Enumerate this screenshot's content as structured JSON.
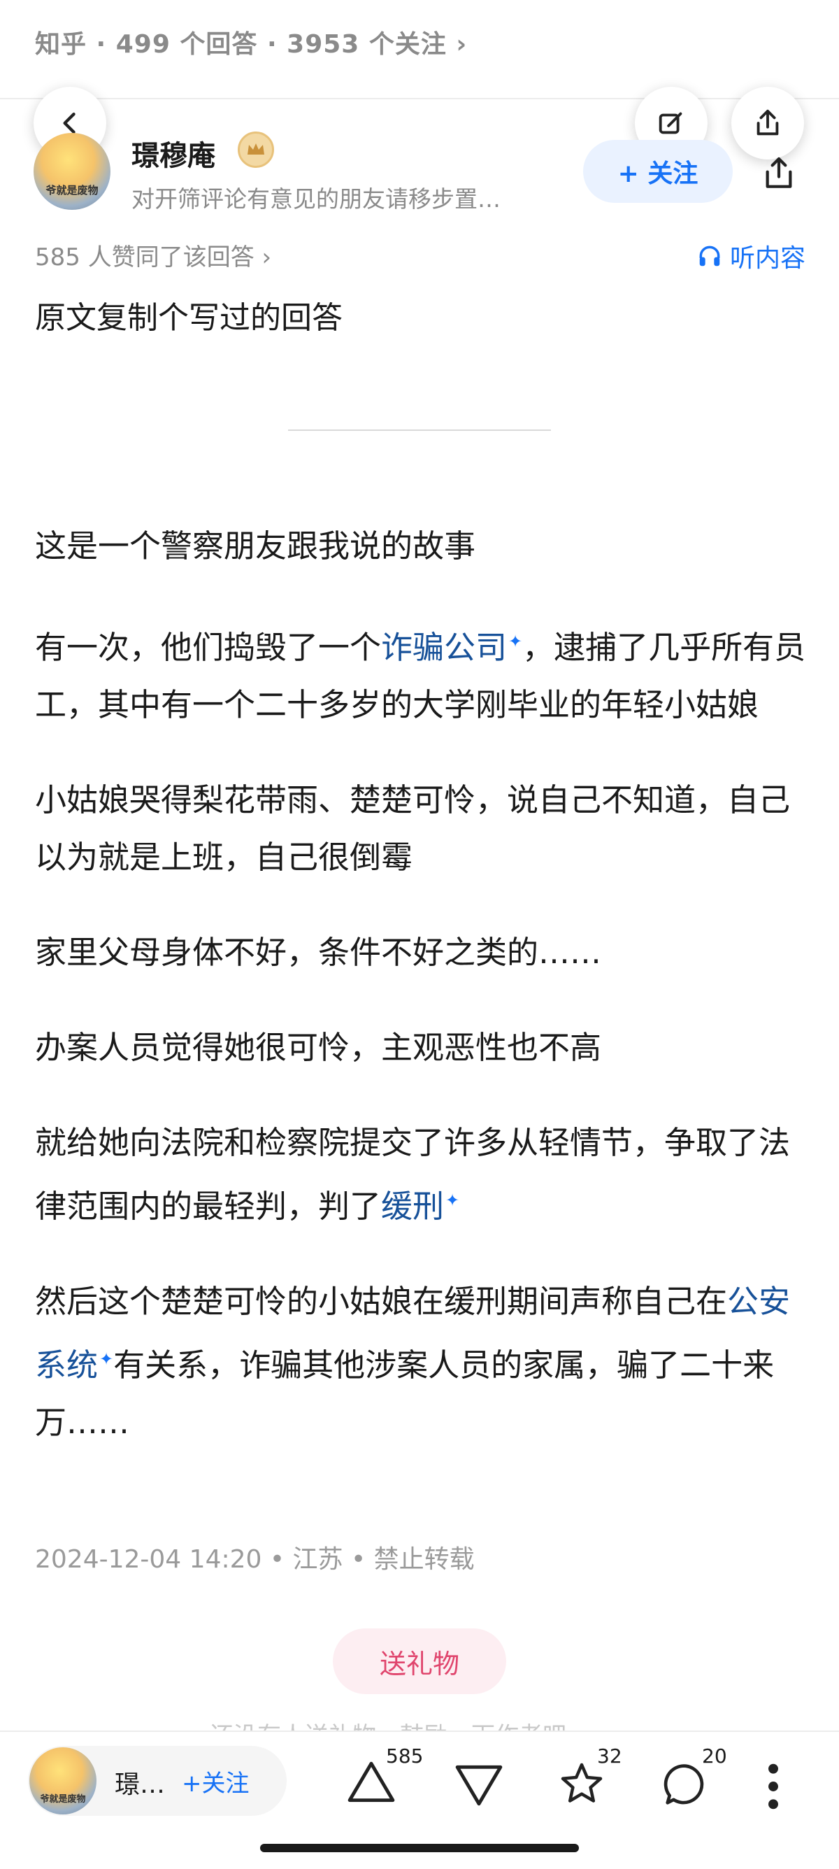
{
  "topbar": {
    "meta": "知乎 · 499 个回答 · 3953 个关注 ›"
  },
  "author": {
    "name": "璟穆庵",
    "avatar_caption": "爷就是废物",
    "bio": "对开筛评论有意见的朋友请移步置…",
    "follow_label": "+ 关注"
  },
  "answer": {
    "upvoted": "585 人赞同了该回答 ›",
    "listen_label": "听内容",
    "intro": "原文复制个写过的回答",
    "p1": "这是一个警察朋友跟我说的故事",
    "p2_a": "有一次，他们捣毁了一个",
    "p2_kw": "诈骗公司",
    "p2_b": "，逮捕了几乎所有员工，其中有一个二十多岁的大学刚毕业的年轻小姑娘",
    "p3": "小姑娘哭得梨花带雨、楚楚可怜，说自己不知道，自己以为就是上班，自己很倒霉",
    "p4": "家里父母身体不好，条件不好之类的……",
    "p5": "办案人员觉得她很可怜，主观恶性也不高",
    "p6_a": "就给她向法院和检察院提交了许多从轻情节，争取了法律范围内的最轻判，判了",
    "p6_kw": "缓刑",
    "p7_a": "然后这个楚楚可怜的小姑娘在缓刑期间声称自己在",
    "p7_kw": "公安系统",
    "p7_b": "有关系，诈骗其他涉案人员的家属，骗了二十来万……",
    "footer_meta": "2024-12-04 14:20 • 江苏 • 禁止转载",
    "gift_label": "送礼物",
    "faded_text": "还没有人送礼物，鼓励一下作者吧"
  },
  "bottombar": {
    "mini_name": "璟…",
    "mini_follow": "+关注",
    "mini_avatar_caption": "爷就是废物",
    "upvote_count": "585",
    "favorite_count": "32",
    "comment_count": "20"
  },
  "icons": {
    "back": "chevron-left-icon",
    "edit": "edit-icon",
    "share": "share-icon",
    "headphones": "headphones-icon",
    "upvote": "triangle-up-icon",
    "downvote": "triangle-down-icon",
    "favorite": "star-icon",
    "comment": "comment-icon",
    "more": "more-vertical-icon"
  },
  "colors": {
    "accent": "#1772f6",
    "link": "#175199",
    "gift": "#e0456d"
  }
}
